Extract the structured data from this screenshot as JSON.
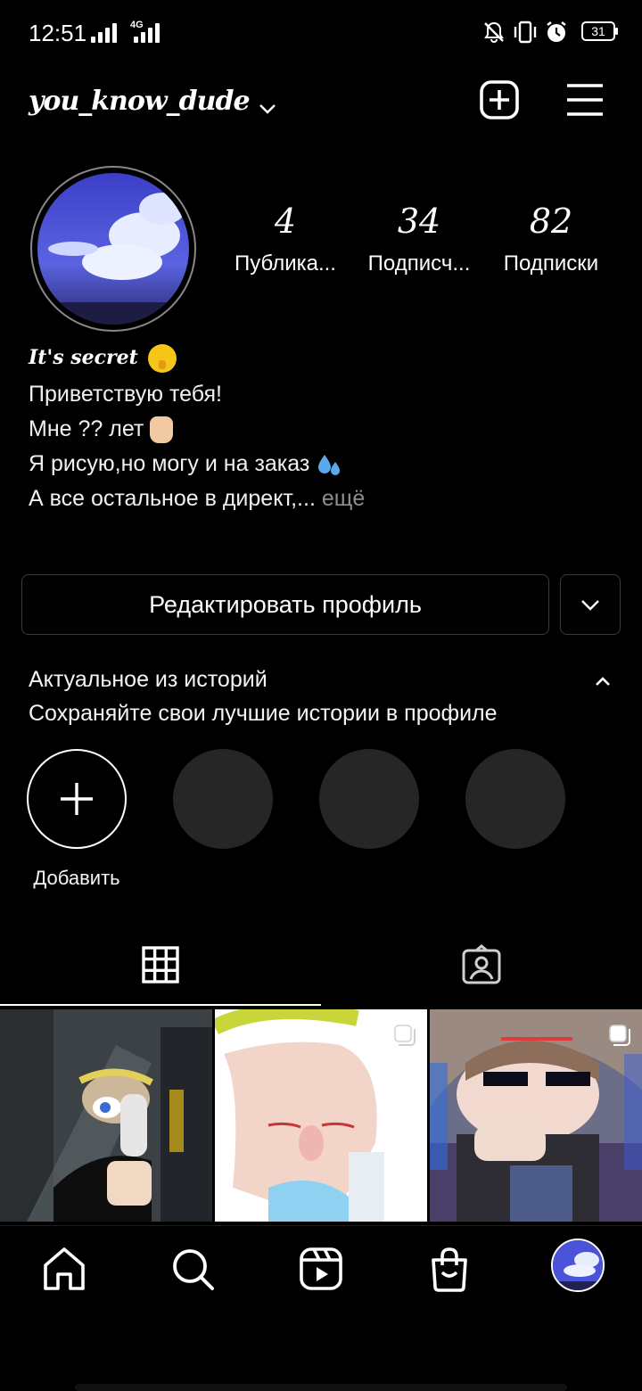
{
  "status_bar": {
    "time": "12:51",
    "network": "4G",
    "battery": "31",
    "icons": [
      "signal-icon",
      "signal-icon",
      "mute-icon",
      "vibrate-icon",
      "alarm-icon",
      "battery-icon"
    ]
  },
  "header": {
    "username": "you_know_dude",
    "icons": [
      "chevron-down-icon",
      "new-post-icon",
      "menu-icon"
    ]
  },
  "profile": {
    "stats": [
      {
        "value": "4",
        "label": "Публика..."
      },
      {
        "value": "34",
        "label": "Подписч..."
      },
      {
        "value": "82",
        "label": "Подписки"
      }
    ],
    "bio_title": "It's secret",
    "bio_lines": [
      "Приветствую тебя!",
      "Мне ?? лет",
      "Я рисую,но могу и на заказ",
      "А все остальное в директ,..."
    ],
    "more": "ещё",
    "edit_button": "Редактировать профиль"
  },
  "highlights": {
    "title": "Актуальное из историй",
    "subtitle": "Сохраняйте свои лучшие истории в профиле",
    "add_label": "Добавить"
  },
  "tabs": [
    "grid-icon",
    "tagged-icon"
  ],
  "bottom_nav": [
    "home-icon",
    "search-icon",
    "reels-icon",
    "shop-icon",
    "profile-avatar"
  ],
  "colors": {
    "background": "#000000",
    "text": "#f5f5f5",
    "muted": "#8e8e8e",
    "placeholder_circle": "#262626",
    "border": "#3a3a3a"
  }
}
